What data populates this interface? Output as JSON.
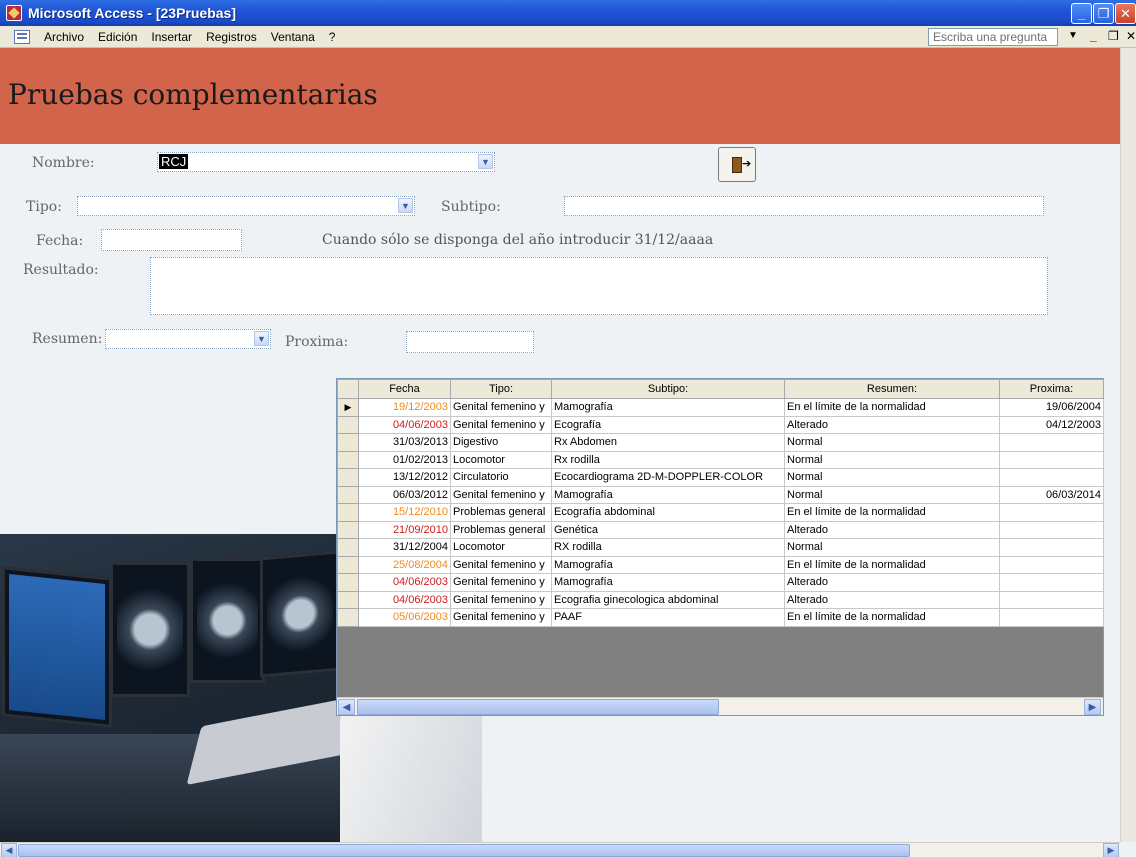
{
  "window": {
    "title": "Microsoft Access - [23Pruebas]",
    "min_icon": "minimize-icon",
    "max_icon": "restore-icon",
    "close_icon": "close-icon"
  },
  "menu": {
    "items": [
      "Archivo",
      "Edición",
      "Insertar",
      "Registros",
      "Ventana",
      "?"
    ],
    "help_placeholder": "Escriba una pregunta"
  },
  "form": {
    "title": "Pruebas complementarias",
    "labels": {
      "nombre": "Nombre:",
      "tipo": "Tipo:",
      "subtipo": "Subtipo:",
      "fecha": "Fecha:",
      "resultado": "Resultado:",
      "resumen": "Resumen:",
      "proxima": "Proxima:"
    },
    "values": {
      "nombre": "RCJ",
      "tipo": "",
      "subtipo": "",
      "fecha": "",
      "resultado": "",
      "resumen": "",
      "proxima": ""
    },
    "hint": "Cuando sólo se disponga del año introducir 31/12/aaaa",
    "exit_icon": "exit-door-icon"
  },
  "datasheet": {
    "columns": [
      "",
      "Fecha",
      "Tipo:",
      "Subtipo:",
      "Resumen:",
      "Proxima:"
    ],
    "rows": [
      {
        "fecha": "19/12/2003",
        "tipo": "Genital femenino y",
        "subtipo": "Mamografía",
        "resumen": "En el límite de la normalidad",
        "proxima": "19/06/2004",
        "color": "orange",
        "current": true
      },
      {
        "fecha": "04/06/2003",
        "tipo": "Genital femenino y",
        "subtipo": "Ecografía",
        "resumen": "Alterado",
        "proxima": "04/12/2003",
        "color": "red"
      },
      {
        "fecha": "31/03/2013",
        "tipo": "Digestivo",
        "subtipo": "Rx Abdomen",
        "resumen": "Normal",
        "proxima": "",
        "color": "black"
      },
      {
        "fecha": "01/02/2013",
        "tipo": "Locomotor",
        "subtipo": "Rx rodilla",
        "resumen": "Normal",
        "proxima": "",
        "color": "black"
      },
      {
        "fecha": "13/12/2012",
        "tipo": "Circulatorio",
        "subtipo": "Ecocardiograma 2D-M-DOPPLER-COLOR",
        "resumen": "Normal",
        "proxima": "",
        "color": "black"
      },
      {
        "fecha": "06/03/2012",
        "tipo": "Genital femenino y",
        "subtipo": "Mamografía",
        "resumen": "Normal",
        "proxima": "06/03/2014",
        "color": "black"
      },
      {
        "fecha": "15/12/2010",
        "tipo": "Problemas general",
        "subtipo": "Ecografía abdominal",
        "resumen": "En el límite de la normalidad",
        "proxima": "",
        "color": "orange"
      },
      {
        "fecha": "21/09/2010",
        "tipo": "Problemas general",
        "subtipo": "Genética",
        "resumen": "Alterado",
        "proxima": "",
        "color": "red"
      },
      {
        "fecha": "31/12/2004",
        "tipo": "Locomotor",
        "subtipo": "RX rodilla",
        "resumen": "Normal",
        "proxima": "",
        "color": "black"
      },
      {
        "fecha": "25/08/2004",
        "tipo": "Genital femenino y",
        "subtipo": "Mamografía",
        "resumen": "En el límite de la normalidad",
        "proxima": "",
        "color": "orange"
      },
      {
        "fecha": "04/06/2003",
        "tipo": "Genital femenino y",
        "subtipo": "Mamografía",
        "resumen": "Alterado",
        "proxima": "",
        "color": "red"
      },
      {
        "fecha": "04/06/2003",
        "tipo": "Genital femenino y",
        "subtipo": "Ecografia ginecologica abdominal",
        "resumen": "Alterado",
        "proxima": "",
        "color": "red"
      },
      {
        "fecha": "05/06/2003",
        "tipo": "Genital femenino y",
        "subtipo": "PAAF",
        "resumen": "En el límite de la normalidad",
        "proxima": "",
        "color": "orange"
      }
    ],
    "colors": {
      "orange": "#f28a1a",
      "red": "#d01c1c",
      "black": "#000000"
    }
  },
  "colors": {
    "header_bg": "#d1644a",
    "form_bg": "#eef2f5",
    "title_bar": "#1f55d6"
  }
}
